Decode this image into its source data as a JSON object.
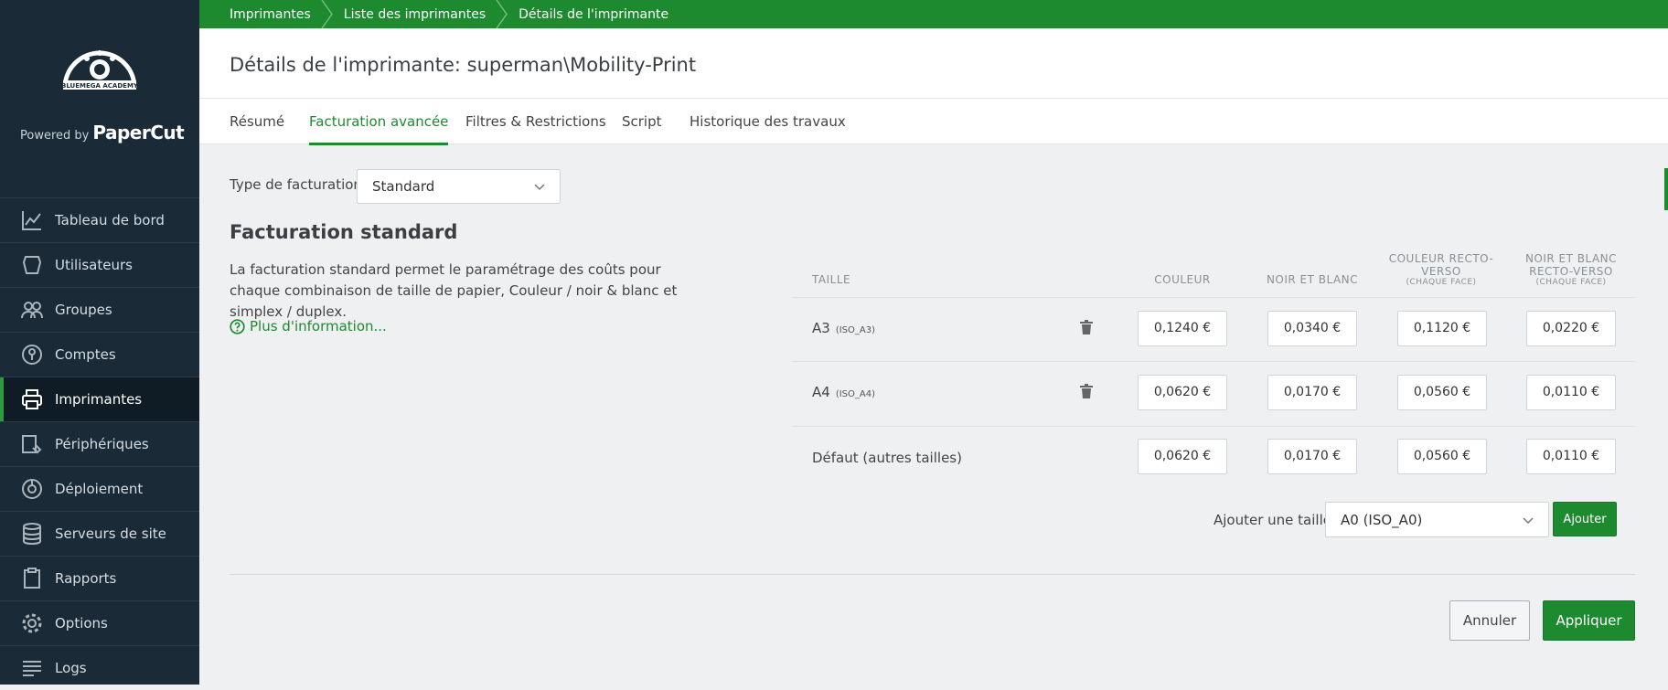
{
  "sidebar": {
    "logo_text": "BLUEMEGA ACADEMY",
    "powered_by": "Powered by",
    "brand": "PaperCut",
    "items": [
      {
        "label": "Tableau de bord",
        "icon": "chart-line-icon"
      },
      {
        "label": "Utilisateurs",
        "icon": "user-icon"
      },
      {
        "label": "Groupes",
        "icon": "users-icon"
      },
      {
        "label": "Comptes",
        "icon": "lock-icon"
      },
      {
        "label": "Imprimantes",
        "icon": "printer-icon",
        "active": true
      },
      {
        "label": "Périphériques",
        "icon": "device-icon"
      },
      {
        "label": "Déploiement",
        "icon": "deploy-icon"
      },
      {
        "label": "Serveurs de site",
        "icon": "database-icon"
      },
      {
        "label": "Rapports",
        "icon": "clipboard-icon"
      },
      {
        "label": "Options",
        "icon": "gear-icon"
      },
      {
        "label": "Logs",
        "icon": "list-icon"
      }
    ]
  },
  "breadcrumb": [
    "Imprimantes",
    "Liste des imprimantes",
    "Détails de l'imprimante"
  ],
  "page_title": "Détails de l'imprimante: superman\\Mobility-Print",
  "tabs": [
    "Résumé",
    "Facturation avancée",
    "Filtres & Restrictions",
    "Script",
    "Historique des travaux"
  ],
  "active_tab": "Facturation avancée",
  "billing": {
    "type_label": "Type de facturation:",
    "type_value": "Standard",
    "section_title": "Facturation standard",
    "description": "La facturation standard permet le paramétrage des coûts pour chaque combinaison de taille de papier, Couleur / noir & blanc et simplex / duplex.",
    "more_info": "Plus d'information..."
  },
  "table": {
    "headers": {
      "size": "TAILLE",
      "color": "COULEUR",
      "bw": "NOIR ET BLANC",
      "color_duplex": "COULEUR RECTO-VERSO",
      "bw_duplex": "NOIR ET BLANC RECTO-VERSO",
      "per_face": "(CHAQUE FACE)"
    },
    "rows": [
      {
        "size": "A3",
        "code": "(ISO_A3)",
        "color": "0,1240 €",
        "bw": "0,0340 €",
        "color_duplex": "0,1120 €",
        "bw_duplex": "0,0220 €"
      },
      {
        "size": "A4",
        "code": "(ISO_A4)",
        "color": "0,0620 €",
        "bw": "0,0170 €",
        "color_duplex": "0,0560 €",
        "bw_duplex": "0,0110 €"
      },
      {
        "size": "Défaut (autres tailles)",
        "code": "",
        "color": "0,0620 €",
        "bw": "0,0170 €",
        "color_duplex": "0,0560 €",
        "bw_duplex": "0,0110 €"
      }
    ]
  },
  "add_size": {
    "label": "Ajouter une taille:",
    "selected": "A0 (ISO_A0)",
    "button": "Ajouter"
  },
  "actions": {
    "cancel": "Annuler",
    "apply": "Appliquer"
  },
  "colors": {
    "accent": "#1e8a30",
    "sidebar_bg": "#1a2a36"
  }
}
